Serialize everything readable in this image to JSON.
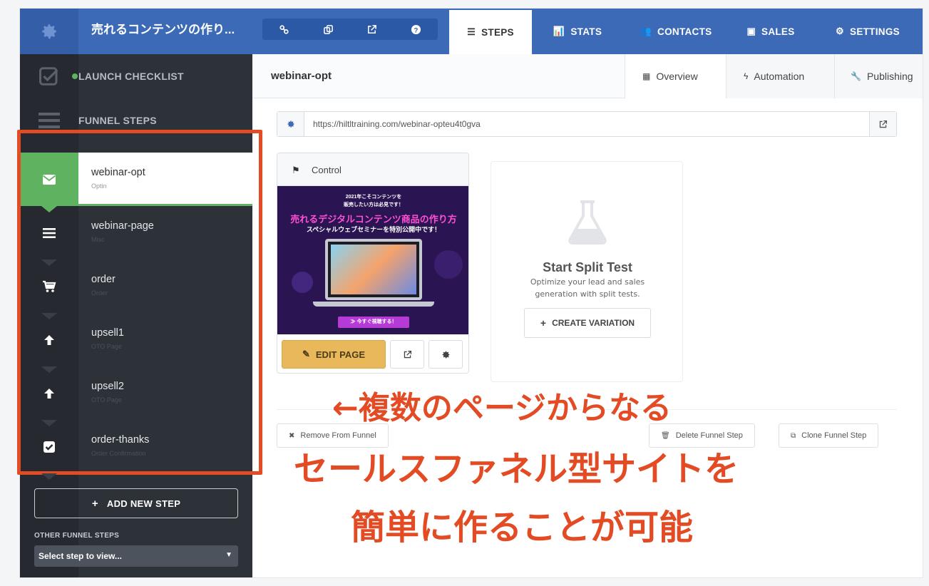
{
  "topbar": {
    "funnel_title": "売れるコンテンツの作り...",
    "icon_buttons": [
      "link-icon",
      "copy-icon",
      "external-link-icon",
      "help-icon"
    ],
    "tabs": [
      {
        "label": "STEPS",
        "icon": "list-icon",
        "active": true
      },
      {
        "label": "STATS",
        "icon": "bar-chart-icon",
        "active": false
      },
      {
        "label": "CONTACTS",
        "icon": "users-icon",
        "active": false
      },
      {
        "label": "SALES",
        "icon": "money-icon",
        "active": false
      },
      {
        "label": "SETTINGS",
        "icon": "gear-icon",
        "active": false
      }
    ]
  },
  "sidebar": {
    "launch_checklist": "LAUNCH CHECKLIST",
    "funnel_steps": "FUNNEL STEPS",
    "steps": [
      {
        "name": "webinar-opt",
        "type": "Optin",
        "icon": "envelope-icon",
        "active": true
      },
      {
        "name": "webinar-page",
        "type": "Misc",
        "icon": "menu-icon",
        "active": false
      },
      {
        "name": "order",
        "type": "Order",
        "icon": "cart-icon",
        "active": false
      },
      {
        "name": "upsell1",
        "type": "OTO Page",
        "icon": "arrow-up-icon",
        "active": false
      },
      {
        "name": "upsell2",
        "type": "OTO Page",
        "icon": "arrow-up-icon",
        "active": false
      },
      {
        "name": "order-thanks",
        "type": "Order Confirmation",
        "icon": "check-square-icon",
        "active": false
      }
    ],
    "add_new_step": "ADD NEW STEP",
    "other_funnel_steps": "OTHER FUNNEL STEPS",
    "select_placeholder": "Select step to view..."
  },
  "main": {
    "step_heading": "webinar-opt",
    "sub_tabs": [
      {
        "label": "Overview",
        "icon": "grid-icon",
        "active": true
      },
      {
        "label": "Automation",
        "icon": "bolt-icon",
        "active": false
      },
      {
        "label": "Publishing",
        "icon": "wrench-icon",
        "active": false
      }
    ],
    "url": "https://hiltltraining.com/webinar-opteu4t0gva",
    "control_label": "Control",
    "preview": {
      "line1": "2021年こそコンテンツを",
      "line2": "販売したい方は必見です！",
      "title": "売れるデジタルコンテンツ商品の作り方",
      "subtitle": "スペシャルウェブセミナーを特別公開中です！",
      "cta": "≫ 今すぐ視聴する！"
    },
    "edit_page": "EDIT PAGE",
    "split_test": {
      "title": "Start Split Test",
      "desc": "Optimize your lead and sales generation with split tests.",
      "button": "CREATE VARIATION"
    },
    "remove_from_funnel": "Remove From Funnel",
    "delete_funnel_step": "Delete Funnel Step",
    "clone_funnel_step": "Clone Funnel Step"
  },
  "annotation": {
    "line1": "←複数のページからなる",
    "line2": "セールスファネル型サイトを",
    "line3": "簡単に作ることが可能",
    "color": "#e34b24"
  },
  "colors": {
    "brand_blue": "#3c6ab7",
    "sidebar_dark": "#2d3239",
    "active_green": "#5fb25f",
    "edit_button": "#e9b85a"
  }
}
